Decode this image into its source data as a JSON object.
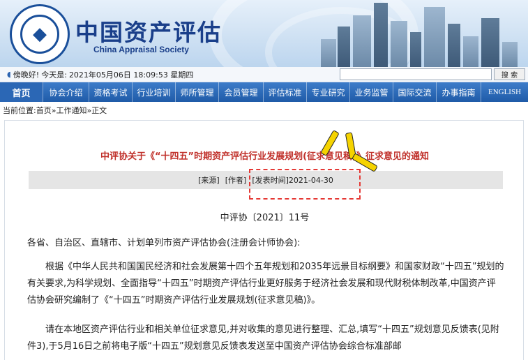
{
  "header": {
    "org_name_cn": "中国资产评估",
    "org_name_en": "China Appraisal Society",
    "logo_ring_text": "China Appraisal Society"
  },
  "infobar": {
    "greeting": "傍晚好!",
    "today_label": "今天是:",
    "datetime": "2021年05月06日 18:09:53 星期四",
    "search_placeholder": "",
    "search_button": "搜 索"
  },
  "nav": {
    "items": [
      {
        "label": "首页"
      },
      {
        "label": "协会介绍"
      },
      {
        "label": "资格考试"
      },
      {
        "label": "行业培训"
      },
      {
        "label": "师所管理"
      },
      {
        "label": "会员管理"
      },
      {
        "label": "评估标准"
      },
      {
        "label": "专业研究"
      },
      {
        "label": "业务监管"
      },
      {
        "label": "国际交流"
      },
      {
        "label": "办事指南"
      },
      {
        "label": "ENGLISH"
      }
    ]
  },
  "breadcrumb": {
    "prefix": "当前位置:",
    "home": "首页",
    "sep": "»",
    "section": "工作通知",
    "sep2": "»",
    "current": "正文"
  },
  "article": {
    "title": "中评协关于《“十四五”时期资产评估行业发展规划(征求意见稿)》征求意见的通知",
    "meta": {
      "source": "[来源]",
      "author": "[作者]",
      "published": "[发表时间]2021-04-30"
    },
    "doc_number": "中评协〔2021〕11号",
    "paragraphs": [
      "各省、自治区、直辖市、计划单列市资产评估协会(注册会计师协会):",
      "根据《中华人民共和国国民经济和社会发展第十四个五年规划和2035年远景目标纲要》和国家财政“十四五”规划的有关要求,为科学规划、全面指导“十四五”时期资产评估行业更好服务于经济社会发展和现代财税体制改革,中国资产评估协会研究编制了《“十四五”时期资产评估行业发展规划(征求意见稿)》。",
      "请在本地区资产评估行业和相关单位征求意见,并对收集的意见进行整理、汇总,填写“十四五”规划意见反馈表(见附件3),于5月16日之前将电子版“十四五”规划意见反馈表发送至中国资产评估协会综合标准部邮"
    ]
  },
  "colors": {
    "nav_bg": "#1f5ba8",
    "title_red": "#c0302a",
    "org_blue": "#1a3f8a",
    "highlight": "#e53935",
    "spark": "#f5d300"
  }
}
